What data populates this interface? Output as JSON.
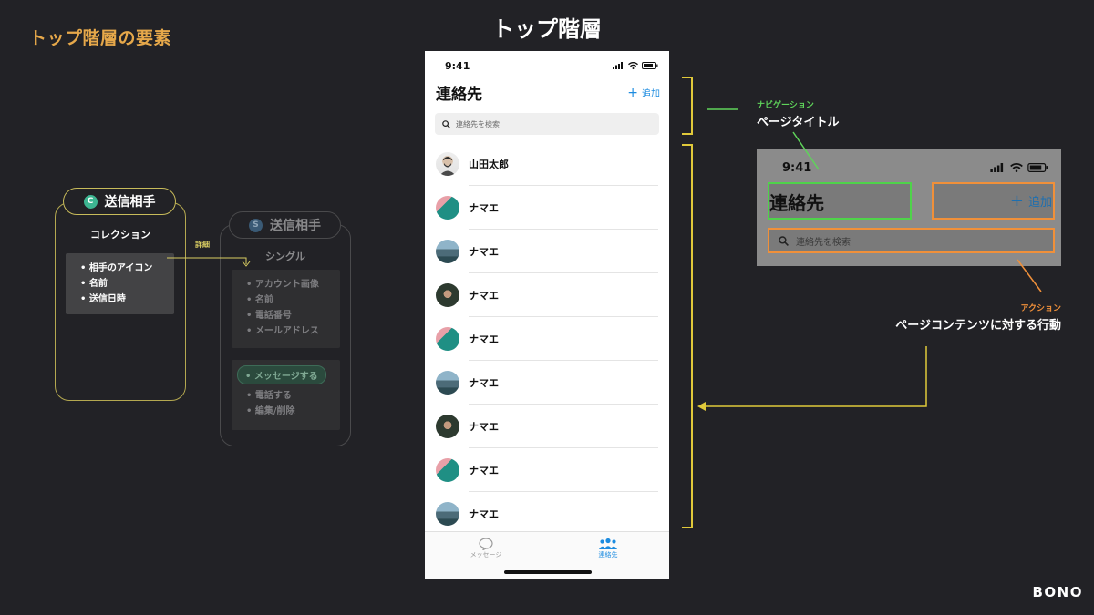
{
  "heading": "トップ階層の要素",
  "center_title": "トップ階層",
  "brand": "BONO",
  "object_main": {
    "badge": "C",
    "title": "送信相手",
    "label": "コレクション",
    "items": [
      "相手のアイコン",
      "名前",
      "送信日時"
    ]
  },
  "detail_label": "詳細",
  "object_dim": {
    "badge": "S",
    "title": "送信相手",
    "label": "シングル",
    "items": [
      "アカウント画像",
      "名前",
      "電話番号",
      "メールアドレス"
    ],
    "action_primary": "メッセージする",
    "actions": [
      "電話する",
      "編集/削除"
    ]
  },
  "phone": {
    "time": "9:41",
    "title": "連絡先",
    "add_label": "追加",
    "search_placeholder": "連絡先を検索",
    "contacts": [
      {
        "name": "山田太郎",
        "avatar": "man-icon"
      },
      {
        "name": "ナマエ",
        "avatar": "teal-portrait-icon"
      },
      {
        "name": "ナマエ",
        "avatar": "mountain-icon"
      },
      {
        "name": "ナマエ",
        "avatar": "dark-portrait-icon"
      },
      {
        "name": "ナマエ",
        "avatar": "teal-portrait-icon"
      },
      {
        "name": "ナマエ",
        "avatar": "mountain-icon"
      },
      {
        "name": "ナマエ",
        "avatar": "dark-portrait-icon"
      },
      {
        "name": "ナマエ",
        "avatar": "teal-portrait-icon"
      },
      {
        "name": "ナマエ",
        "avatar": "mountain-icon"
      }
    ],
    "tabs": [
      {
        "label": "メッセージ",
        "icon": "speech-bubble-icon"
      },
      {
        "label": "連絡先",
        "icon": "people-icon"
      }
    ]
  },
  "annotations": {
    "nav_small": "ナビゲーション",
    "nav_big": "ページタイトル",
    "action_small": "アクション",
    "action_big": "ページコンテンツに対する行動"
  },
  "zoom": {
    "time": "9:41",
    "title": "連絡先",
    "add_label": "追加",
    "search_placeholder": "連絡先を検索"
  },
  "colors": {
    "background": "#222226",
    "heading": "#e6a84a",
    "card_border": "#b4a850",
    "bracket": "#e0c93a",
    "navigation": "#5fd35a",
    "action": "#f0903a",
    "link_blue": "#1d8ce0",
    "collection_badge": "#3db591"
  }
}
